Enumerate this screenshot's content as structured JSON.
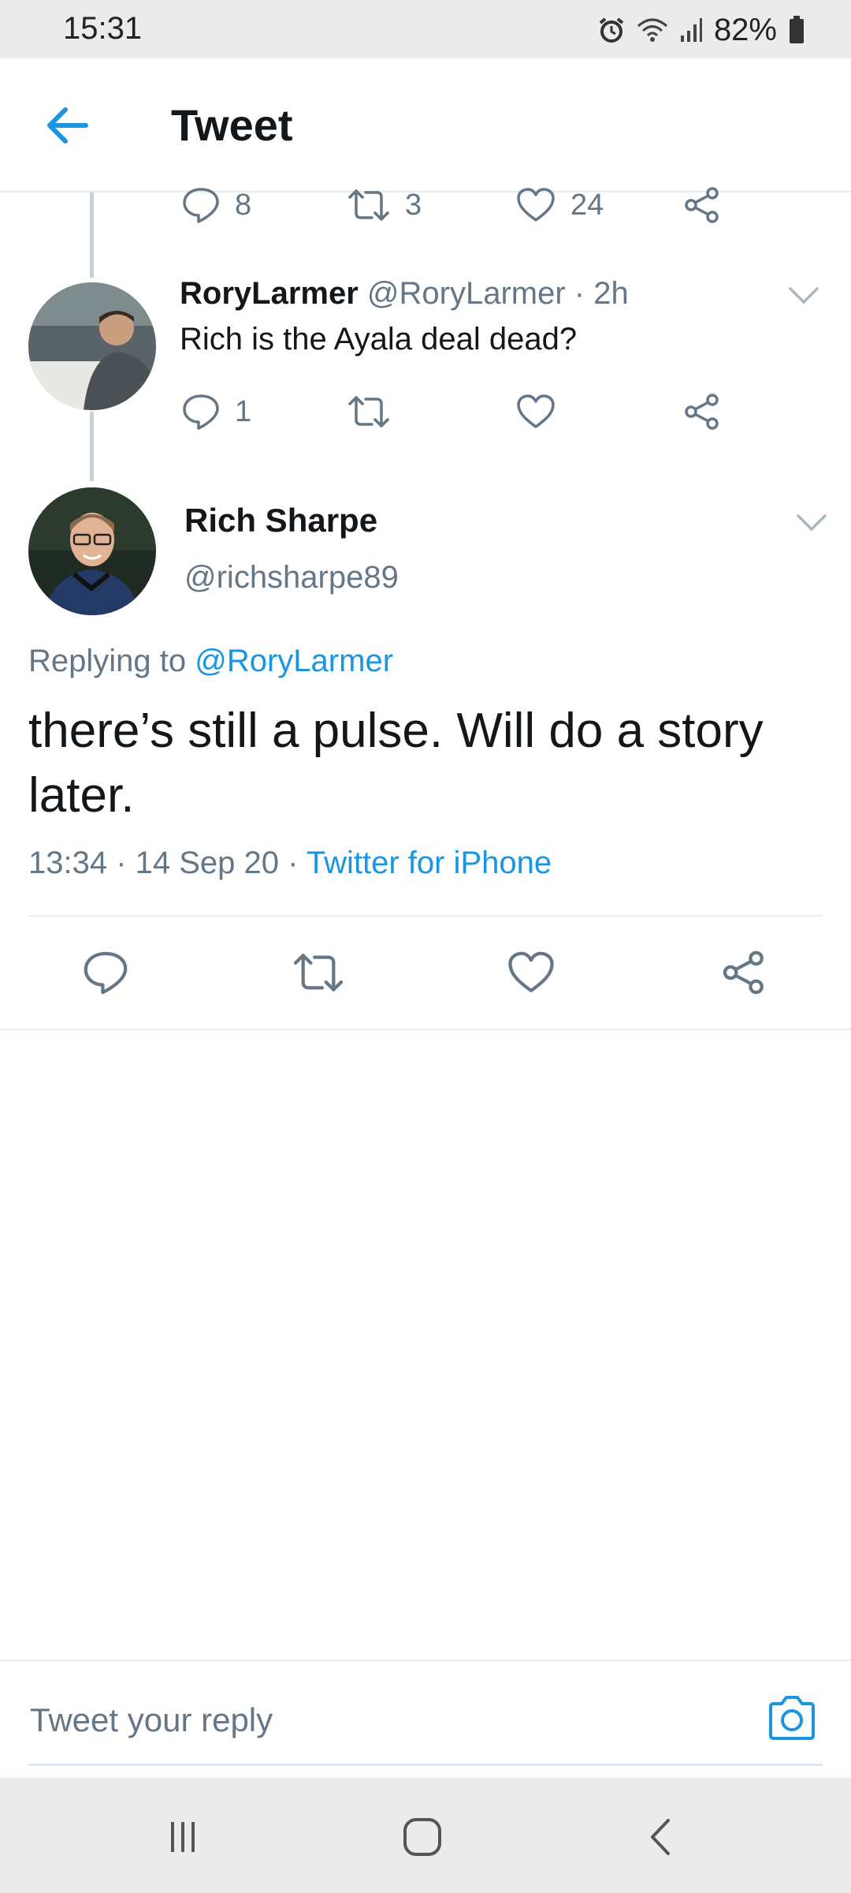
{
  "status_bar": {
    "time": "15:31",
    "battery": "82%"
  },
  "header": {
    "title": "Tweet"
  },
  "previous_tweet": {
    "reply_count": "8",
    "retweet_count": "3",
    "like_count": "24"
  },
  "reply_tweet": {
    "name": "RoryLarmer",
    "handle": "@RoryLarmer",
    "time": "· 2h",
    "text": "Rich is the Ayala deal dead?",
    "reply_count": "1"
  },
  "main_tweet": {
    "name": "Rich Sharpe",
    "handle": "@richsharpe89",
    "replying_prefix": "Replying to",
    "replying_to": "@RoryLarmer",
    "text": "there’s still a pulse. Will do a story later.",
    "time": "13:34 · 14 Sep 20 ·",
    "source": "Twitter for iPhone"
  },
  "reply_bar": {
    "placeholder": "Tweet your reply"
  },
  "colors": {
    "accent": "#1b95e0",
    "muted": "#657786",
    "text": "#14171a",
    "divider": "#e6ecf0"
  },
  "icons": [
    "back-arrow-icon",
    "alarm-icon",
    "wifi-icon",
    "signal-icon",
    "battery-icon",
    "reply-icon",
    "retweet-icon",
    "like-icon",
    "share-icon",
    "chevron-down-icon",
    "camera-icon",
    "recent-apps-icon",
    "home-icon",
    "back-nav-icon"
  ]
}
